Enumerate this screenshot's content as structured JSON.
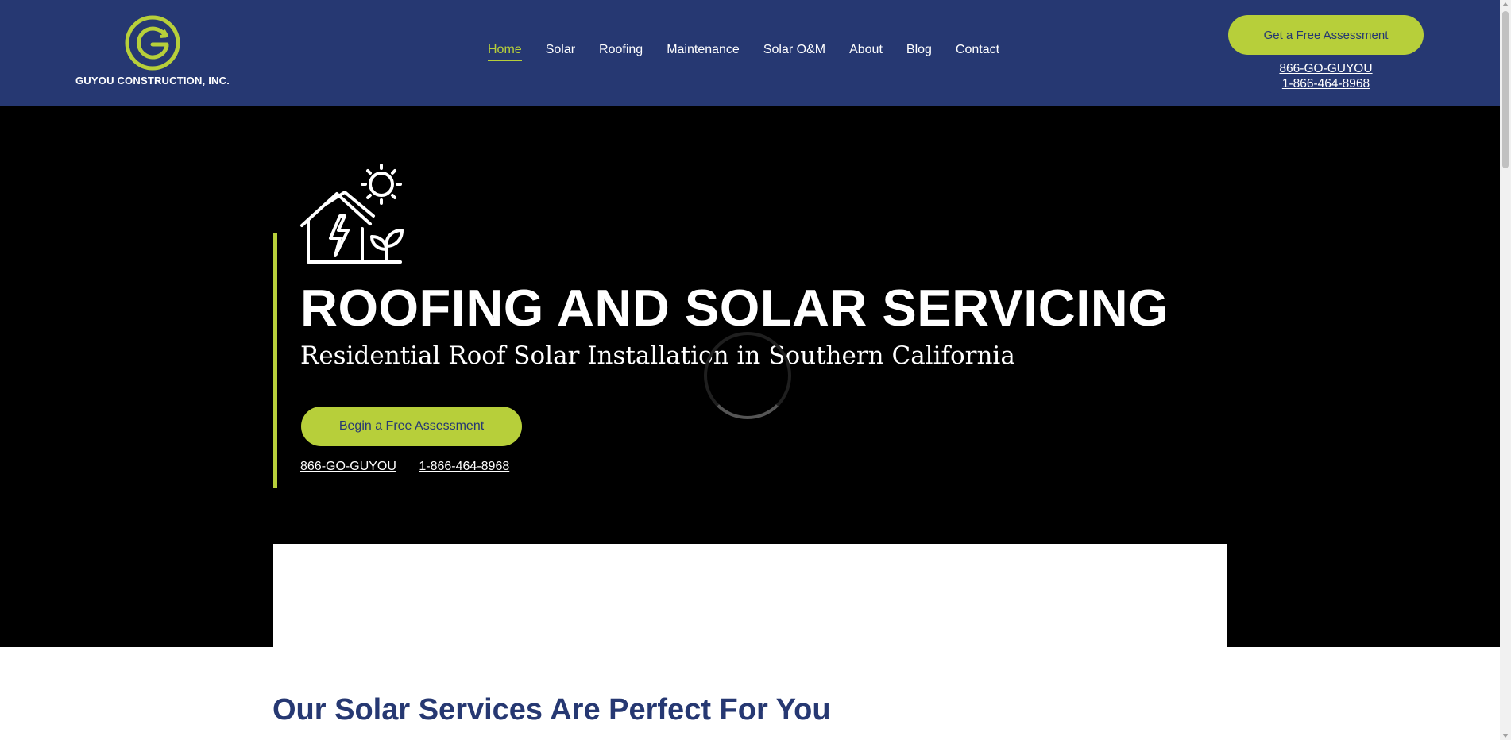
{
  "header": {
    "logo_text": "GUYOU CONSTRUCTION, INC.",
    "nav": [
      {
        "label": "Home",
        "active": true
      },
      {
        "label": "Solar"
      },
      {
        "label": "Roofing"
      },
      {
        "label": "Maintenance"
      },
      {
        "label": "Solar O&M"
      },
      {
        "label": "About"
      },
      {
        "label": "Blog"
      },
      {
        "label": "Contact"
      }
    ],
    "cta_label": "Get a Free Assessment",
    "phone_vanity": "866-GO-GUYOU",
    "phone_number": "1-866-464-8968"
  },
  "hero": {
    "icon": "house-solar-icon",
    "title": "ROOFING AND SOLAR SERVICING",
    "subtitle": "Residential Roof Solar Installation in Southern California",
    "cta_label": "Begin a Free Assessment",
    "phone_vanity": "866-GO-GUYOU",
    "phone_number": "1-866-464-8968"
  },
  "section": {
    "title": "Our Solar Services Are Perfect For You"
  },
  "colors": {
    "header_bg": "#263872",
    "accent": "#b7cf3a",
    "hero_bg": "#000000",
    "heading": "#263872"
  }
}
